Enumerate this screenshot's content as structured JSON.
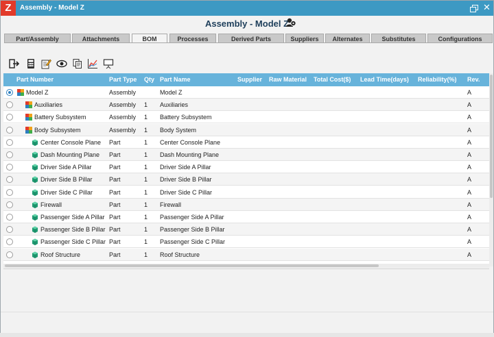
{
  "window": {
    "title": "Assembly - Model Z",
    "logo_letter": "Z",
    "close_glyph": "✕"
  },
  "header": {
    "title": "Assembly - Model Z",
    "icon": "user-group-icon"
  },
  "tabs": [
    {
      "label": "Part/Assembly",
      "active": false
    },
    {
      "label": "Attachments",
      "active": false
    },
    {
      "label": "BOM",
      "active": true
    },
    {
      "label": "Processes",
      "active": false
    },
    {
      "label": "Derived Parts",
      "active": false
    },
    {
      "label": "Suppliers",
      "active": false
    },
    {
      "label": "Alternates",
      "active": false
    },
    {
      "label": "Substitutes",
      "active": false
    },
    {
      "label": "Configurations",
      "active": false
    }
  ],
  "toolbar": [
    {
      "icon": "import-icon"
    },
    {
      "icon": "calculator-icon"
    },
    {
      "icon": "edit-icon"
    },
    {
      "icon": "view-icon"
    },
    {
      "icon": "copy-icon"
    },
    {
      "icon": "chart-icon"
    },
    {
      "icon": "presentation-icon"
    }
  ],
  "columns": {
    "part_number": "Part Number",
    "part_type": "Part Type",
    "qty": "Qty",
    "part_name": "Part Name",
    "supplier": "Supplier",
    "raw_material": "Raw Material",
    "total_cost": "Total Cost($)",
    "lead_time": "Lead Time(days)",
    "reliability": "Reliability(%)",
    "rev": "Rev."
  },
  "rows": [
    {
      "part_number": "Model Z",
      "part_type": "Assembly",
      "qty": "",
      "part_name": "Model Z",
      "rev": "A",
      "level": 0,
      "kind": "assembly",
      "selected": true
    },
    {
      "part_number": "Auxiliaries",
      "part_type": "Assembly",
      "qty": "1",
      "part_name": "Auxiliaries",
      "rev": "A",
      "level": 1,
      "kind": "assembly",
      "selected": false
    },
    {
      "part_number": "Battery Subsystem",
      "part_type": "Assembly",
      "qty": "1",
      "part_name": "Battery Subsystem",
      "rev": "A",
      "level": 1,
      "kind": "assembly",
      "selected": false
    },
    {
      "part_number": "Body Subsystem",
      "part_type": "Assembly",
      "qty": "1",
      "part_name": "Body System",
      "rev": "A",
      "level": 1,
      "kind": "assembly",
      "selected": false
    },
    {
      "part_number": "Center Console Plane",
      "part_type": "Part",
      "qty": "1",
      "part_name": "Center Console Plane",
      "rev": "A",
      "level": 2,
      "kind": "part",
      "selected": false
    },
    {
      "part_number": "Dash Mounting Plane",
      "part_type": "Part",
      "qty": "1",
      "part_name": "Dash Mounting Plane",
      "rev": "A",
      "level": 2,
      "kind": "part",
      "selected": false
    },
    {
      "part_number": "Driver Side A Pillar",
      "part_type": "Part",
      "qty": "1",
      "part_name": "Driver Side A Pillar",
      "rev": "A",
      "level": 2,
      "kind": "part",
      "selected": false
    },
    {
      "part_number": "Driver Side B Pillar",
      "part_type": "Part",
      "qty": "1",
      "part_name": "Driver Side B Pillar",
      "rev": "A",
      "level": 2,
      "kind": "part",
      "selected": false
    },
    {
      "part_number": "Driver Side C Pillar",
      "part_type": "Part",
      "qty": "1",
      "part_name": "Driver Side C Pillar",
      "rev": "A",
      "level": 2,
      "kind": "part",
      "selected": false
    },
    {
      "part_number": "Firewall",
      "part_type": "Part",
      "qty": "1",
      "part_name": "Firewall",
      "rev": "A",
      "level": 2,
      "kind": "part",
      "selected": false
    },
    {
      "part_number": "Passenger Side A Pillar",
      "part_type": "Part",
      "qty": "1",
      "part_name": "Passenger Side A Pillar",
      "rev": "A",
      "level": 2,
      "kind": "part",
      "selected": false
    },
    {
      "part_number": "Passenger Side B Pillar",
      "part_type": "Part",
      "qty": "1",
      "part_name": "Passenger Side B Pillar",
      "rev": "A",
      "level": 2,
      "kind": "part",
      "selected": false
    },
    {
      "part_number": "Passenger Side C Pillar",
      "part_type": "Part",
      "qty": "1",
      "part_name": "Passenger Side C Pillar",
      "rev": "A",
      "level": 2,
      "kind": "part",
      "selected": false
    },
    {
      "part_number": "Roof Structure",
      "part_type": "Part",
      "qty": "1",
      "part_name": "Roof Structure",
      "rev": "A",
      "level": 2,
      "kind": "part",
      "selected": false
    }
  ],
  "colors": {
    "titlebar": "#3d99c3",
    "logo": "#e23a2a",
    "grid_header": "#67b3db",
    "radio_selected": "#2d7fc0"
  }
}
